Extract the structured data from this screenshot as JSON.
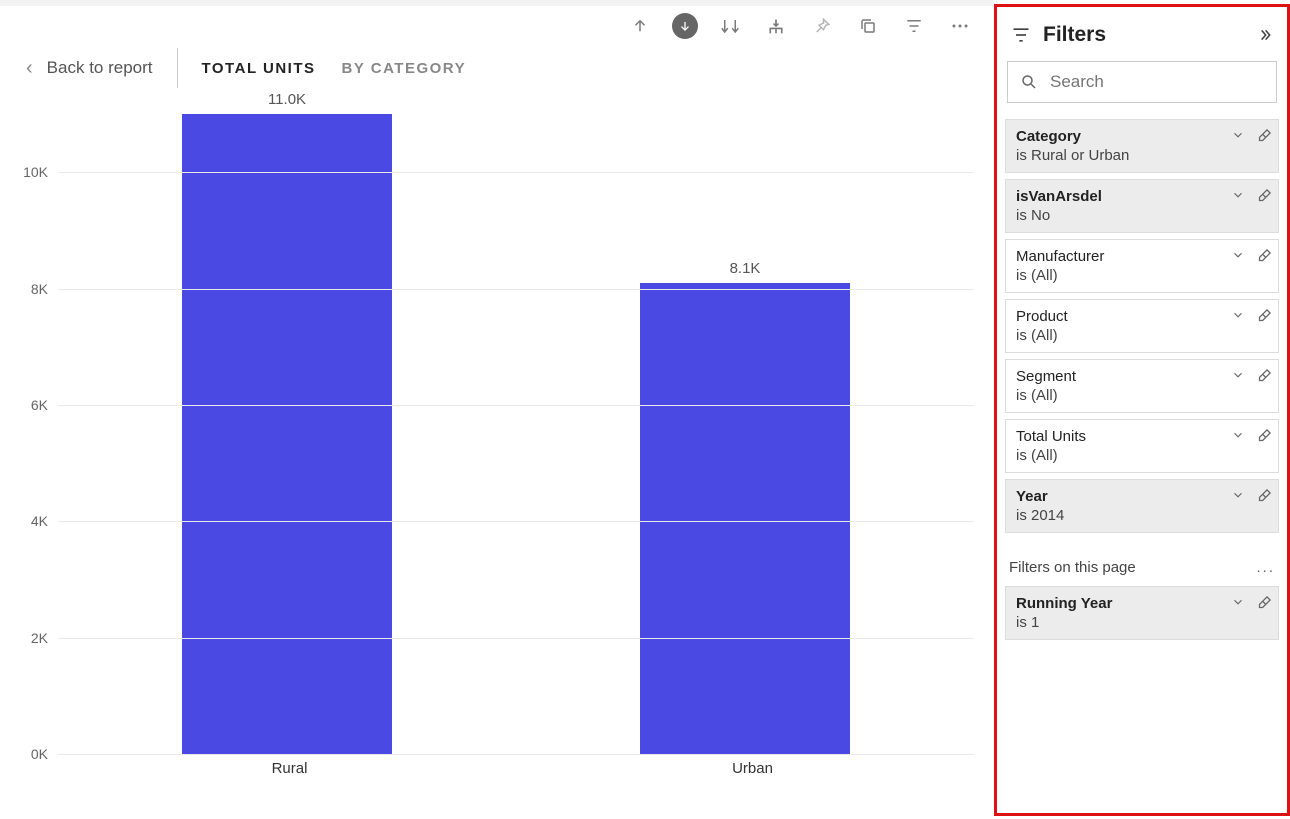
{
  "toolbar": {
    "back_label": "Back to report",
    "tabs": [
      {
        "label": "TOTAL UNITS",
        "active": true
      },
      {
        "label": "BY CATEGORY",
        "active": false
      }
    ]
  },
  "chart_data": {
    "type": "bar",
    "categories": [
      "Rural",
      "Urban"
    ],
    "values": [
      11000,
      8100
    ],
    "value_labels": [
      "11.0K",
      "8.1K"
    ],
    "title": "",
    "xlabel": "",
    "ylabel": "",
    "ylim": [
      0,
      11000
    ],
    "y_ticks": [
      0,
      2000,
      4000,
      6000,
      8000,
      10000
    ],
    "y_tick_labels": [
      "0K",
      "2K",
      "4K",
      "6K",
      "8K",
      "10K"
    ],
    "bar_color": "#4b49e4"
  },
  "filters": {
    "title": "Filters",
    "search_placeholder": "Search",
    "cards": [
      {
        "name": "Category",
        "value": "is Rural or Urban",
        "applied": true
      },
      {
        "name": "isVanArsdel",
        "value": "is No",
        "applied": true
      },
      {
        "name": "Manufacturer",
        "value": "is (All)",
        "applied": false
      },
      {
        "name": "Product",
        "value": "is (All)",
        "applied": false
      },
      {
        "name": "Segment",
        "value": "is (All)",
        "applied": false
      },
      {
        "name": "Total Units",
        "value": "is (All)",
        "applied": false
      },
      {
        "name": "Year",
        "value": "is 2014",
        "applied": true
      }
    ],
    "page_section_label": "Filters on this page",
    "page_cards": [
      {
        "name": "Running Year",
        "value": "is 1",
        "applied": true
      }
    ]
  }
}
